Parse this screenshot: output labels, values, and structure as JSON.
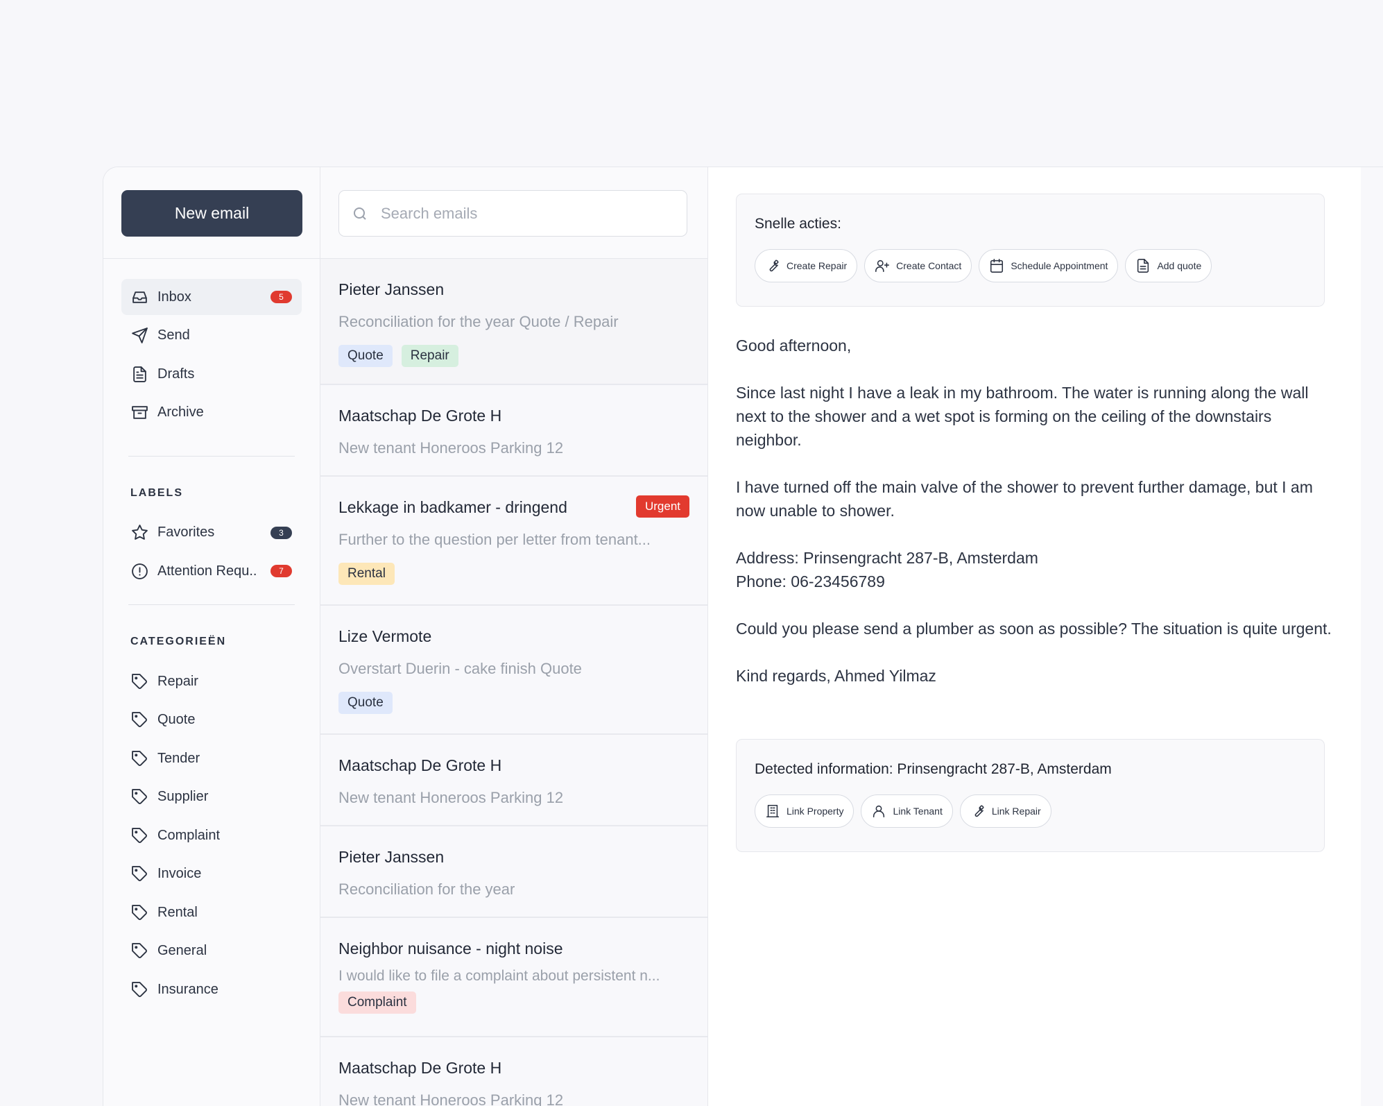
{
  "sidebar": {
    "new_email_label": "New email",
    "nav": [
      {
        "label": "Inbox",
        "icon": "inbox-icon",
        "badge": "5",
        "active": true
      },
      {
        "label": "Send",
        "icon": "send-icon"
      },
      {
        "label": "Drafts",
        "icon": "drafts-icon"
      },
      {
        "label": "Archive",
        "icon": "archive-icon"
      }
    ],
    "labels_title": "LABELS",
    "labels": [
      {
        "label": "Favorites",
        "icon": "star-icon",
        "badge": "3"
      },
      {
        "label": "Attention Requ..",
        "icon": "alert-circle-icon",
        "badge": "7"
      }
    ],
    "categories_title": "CATEGORIEËN",
    "categories": [
      "Repair",
      "Quote",
      "Tender",
      "Supplier",
      "Complaint",
      "Invoice",
      "Rental",
      "General",
      "Insurance"
    ]
  },
  "search": {
    "placeholder": "Search emails"
  },
  "emails": [
    {
      "sender": "Pieter Janssen",
      "subject": "Reconciliation for the year Quote / Repair",
      "tags": [
        "Quote",
        "Repair"
      ]
    },
    {
      "sender": "Maatschap De Grote H",
      "subject": "New tenant Honeroos Parking 12"
    },
    {
      "sender": "Lekkage in badkamer - dringend",
      "subject": "Further to the question per letter from tenant...",
      "tags": [
        "Rental"
      ],
      "urgent": "Urgent"
    },
    {
      "sender": "Lize Vermote",
      "subject": "Overstart Duerin - cake finish Quote",
      "tags": [
        "Quote"
      ]
    },
    {
      "sender": "Maatschap De Grote H",
      "subject": "New tenant Honeroos Parking 12"
    },
    {
      "sender": "Pieter Janssen",
      "subject": "Reconciliation for the year"
    },
    {
      "sender": "Neighbor nuisance - night noise",
      "subject": "I would like to file a complaint about persistent n...",
      "tags": [
        "Complaint"
      ]
    },
    {
      "sender": "Maatschap De Grote H",
      "subject": "New tenant Honeroos Parking 12"
    }
  ],
  "quick_actions": {
    "title": "Snelle acties:",
    "buttons": [
      {
        "label": "Create Repair",
        "icon": "wrench-icon"
      },
      {
        "label": "Create Contact",
        "icon": "user-plus-icon"
      },
      {
        "label": "Schedule Appointment",
        "icon": "calendar-icon"
      },
      {
        "label": "Add quote",
        "icon": "document-icon"
      }
    ]
  },
  "message": {
    "greeting": "Good afternoon,",
    "p1": "Since last night I have a leak in my bathroom. The water is running along the wall next to the shower and a wet spot is forming on the ceiling of the downstairs neighbor.",
    "p2": "I have turned off the main valve of the shower to prevent further damage, but I am now unable to shower.",
    "address": "Address: Prinsengracht 287-B, Amsterdam",
    "phone": "Phone: 06-23456789",
    "p3": "Could you please send a plumber as soon as possible? The situation is quite urgent.",
    "signoff": "Kind regards, Ahmed Yilmaz"
  },
  "detected": {
    "title": "Detected information: Prinsengracht 287-B, Amsterdam",
    "buttons": [
      {
        "label": "Link Property",
        "icon": "building-icon"
      },
      {
        "label": "Link Tenant",
        "icon": "user-icon"
      },
      {
        "label": "Link Repair",
        "icon": "wrench-icon"
      }
    ]
  },
  "colors": {
    "accent_dark": "#353f53",
    "badge_red": "#e03a2f",
    "urgent_red": "#e23a2e"
  }
}
